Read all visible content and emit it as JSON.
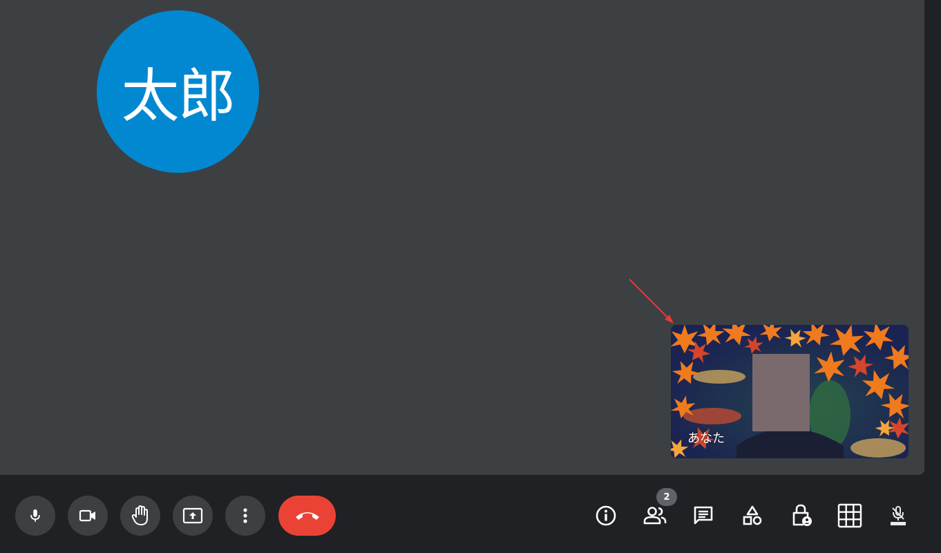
{
  "main": {
    "avatar": {
      "initials": "太郎",
      "color": "#0288d1"
    },
    "self_tile": {
      "name": "あなた"
    }
  },
  "controls": {
    "left": [
      {
        "name": "microphone",
        "icon": "mic-icon"
      },
      {
        "name": "camera",
        "icon": "videocam-icon"
      },
      {
        "name": "raise-hand",
        "icon": "hand-icon"
      },
      {
        "name": "present-screen",
        "icon": "present-icon"
      },
      {
        "name": "more-options",
        "icon": "more-vert-icon"
      },
      {
        "name": "leave-call",
        "icon": "call-end-icon",
        "color": "#ea4335"
      }
    ],
    "right": [
      {
        "name": "meeting-details",
        "icon": "info-icon"
      },
      {
        "name": "people",
        "icon": "people-icon",
        "badge": "2"
      },
      {
        "name": "chat",
        "icon": "chat-icon"
      },
      {
        "name": "activities",
        "icon": "activities-icon"
      },
      {
        "name": "host-controls",
        "icon": "lock-person-icon"
      },
      {
        "name": "layout",
        "icon": "grid-icon"
      },
      {
        "name": "captions",
        "icon": "captions-mic-icon"
      }
    ]
  },
  "colors": {
    "background": "#202124",
    "stage": "#3c4043",
    "button": "#3c4043",
    "end_call": "#ea4335",
    "badge": "#5f6368",
    "annotation_arrow": "#e53935"
  }
}
